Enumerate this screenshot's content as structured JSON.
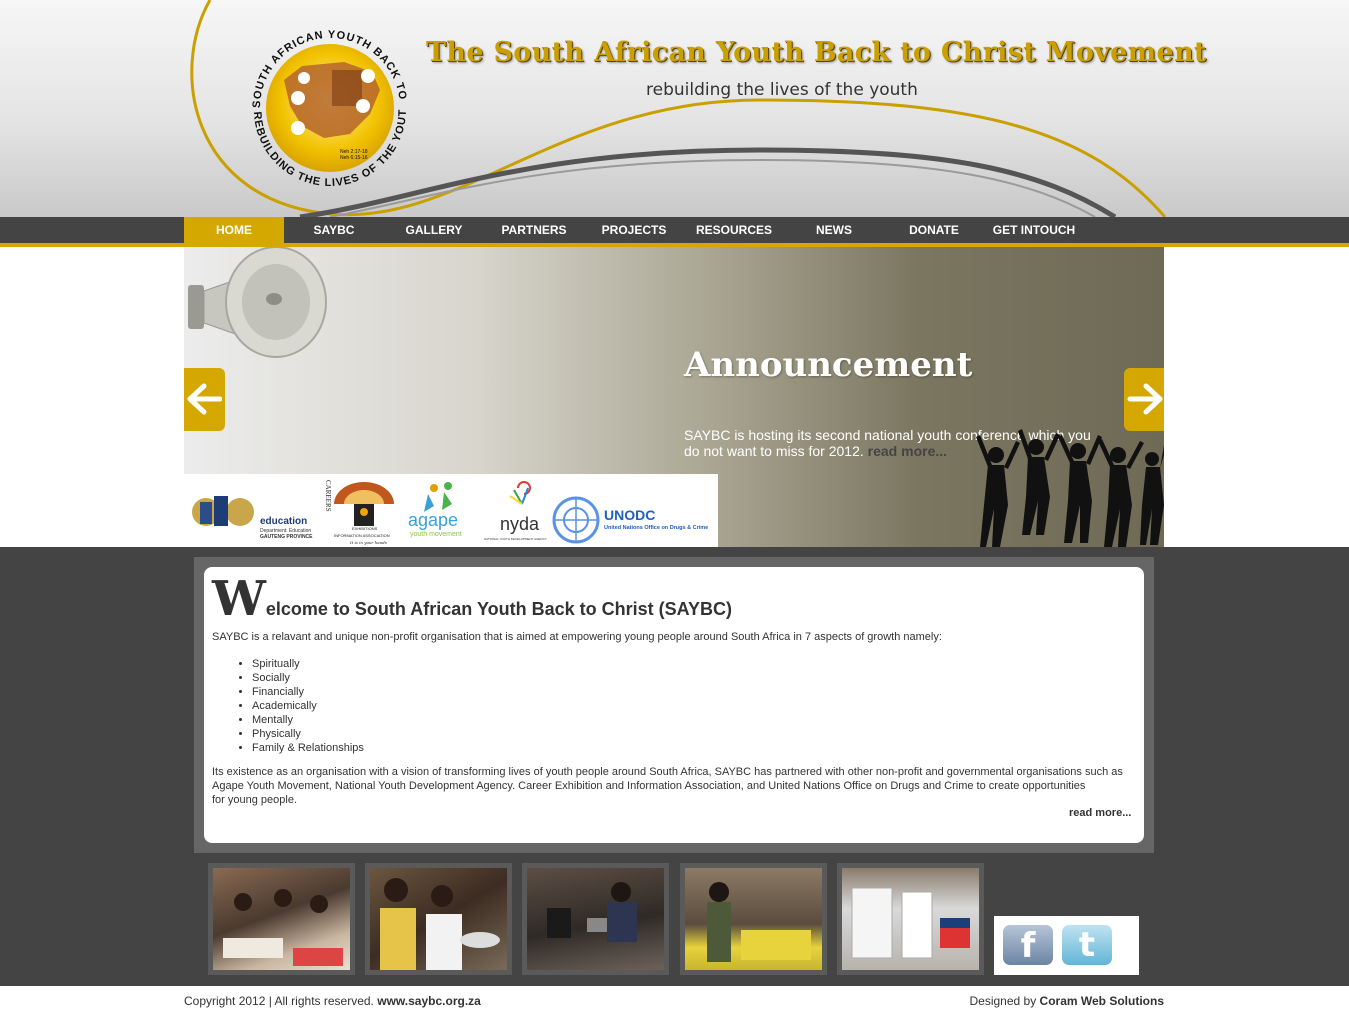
{
  "header": {
    "title": "The South African Youth Back to Christ Movement",
    "tagline": "rebuilding the lives of the youth",
    "logo": {
      "ring_text_top": "SOUTH AFRICAN YOUTH BACK TO CHRIST",
      "ring_text_bottom": "REBUILDING THE LIVES OF THE YOUTH",
      "ref_line1": "Neh 2:17-18",
      "ref_line2": "Neh 6:15-16"
    }
  },
  "nav": {
    "items": [
      {
        "label": "HOME",
        "active": true
      },
      {
        "label": "SAYBC"
      },
      {
        "label": "GALLERY"
      },
      {
        "label": "PARTNERS"
      },
      {
        "label": "PROJECTS"
      },
      {
        "label": "RESOURCES"
      },
      {
        "label": "NEWS"
      },
      {
        "label": "DONATE"
      },
      {
        "label": "GET INTOUCH"
      }
    ]
  },
  "banner": {
    "heading": "Announcement",
    "text": "SAYBC is hosting its second national youth conference which you do not want to miss for 2012.",
    "read_more": "read more...",
    "partners": {
      "education_line1": "education",
      "education_line2": "Department: Education",
      "education_line3": "GAUTENG PROVINCE",
      "careers_vertical": "CAREERS",
      "exhibitions": "EXHIBITIONS",
      "info_assoc": "INFORMATION ASSOCIATION",
      "careers_tagline": "It is in your hands",
      "agape": "agape",
      "agape_sub": "youth movement",
      "nyda": "nyda",
      "nyda_sub": "NATIONAL YOUTH DEVELOPMENT AGENCY",
      "unodc": "UNODC",
      "unodc_sub": "United Nations Office on Drugs & Crime"
    }
  },
  "welcome": {
    "big_letter": "W",
    "title_rest": "elcome to South African Youth Back to Christ (SAYBC)",
    "intro": "SAYBC is a relavant and unique non-profit organisation that is aimed at empowering young people around South Africa in 7 aspects of growth namely:",
    "aspects": [
      "Spiritually",
      "Socially",
      "Financially",
      "Academically",
      "Mentally",
      "Physically",
      "Family & Relationships"
    ],
    "body_line1": "Its existence as an organisation with a vision of transforming lives of youth people around South Africa, SAYBC has partnered with other non-profit and governmental organisations such as",
    "body_line2": "Agape Youth Movement, National Youth Development Agency. Career Exhibition and Information Association, and United Nations Office on Drugs and Crime to create opportunities",
    "body_line3": "for young people.",
    "read_more": "read more..."
  },
  "social": {
    "facebook_glyph": "f",
    "twitter_glyph": "t"
  },
  "footer": {
    "copyright": "Copyright 2012 | All rights reserved.",
    "site": "www.saybc.org.za",
    "designed_by": "Designed by",
    "designer": "Coram Web Solutions"
  },
  "colors": {
    "accent_gold": "#d4a800",
    "nav_dark": "#444444",
    "content_bg": "#444444"
  }
}
